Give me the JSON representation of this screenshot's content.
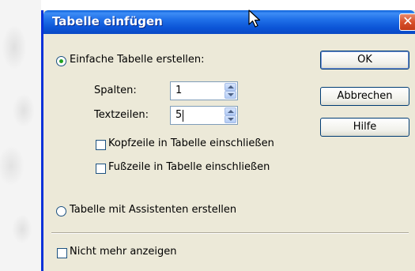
{
  "dialog": {
    "title": "Tabelle einfügen",
    "close_glyph": "✕",
    "options": {
      "simple_table_label": "Einfache Tabelle erstellen:",
      "simple_table_selected": true,
      "wizard_label": "Tabelle mit Assistenten erstellen",
      "wizard_selected": false
    },
    "columns": {
      "label": "Spalten:",
      "value": "1"
    },
    "rows": {
      "label": "Textzeilen:",
      "value": "5"
    },
    "header_row": {
      "label": "Kopfzeile in Tabelle einschließen",
      "checked": false
    },
    "footer_row": {
      "label": "Fußzeile in Tabelle einschließen",
      "checked": false
    },
    "dont_show": {
      "label": "Nicht mehr anzeigen",
      "checked": false
    },
    "buttons": {
      "ok": "OK",
      "cancel": "Abbrechen",
      "help": "Hilfe"
    }
  },
  "colors": {
    "titlebar": "#0b54d6",
    "dialog_bg": "#ece9d8",
    "close": "#d8502a"
  },
  "icons": [
    "close-icon",
    "mouse-pointer-icon",
    "spin-up-arrow-icon",
    "spin-down-arrow-icon"
  ]
}
